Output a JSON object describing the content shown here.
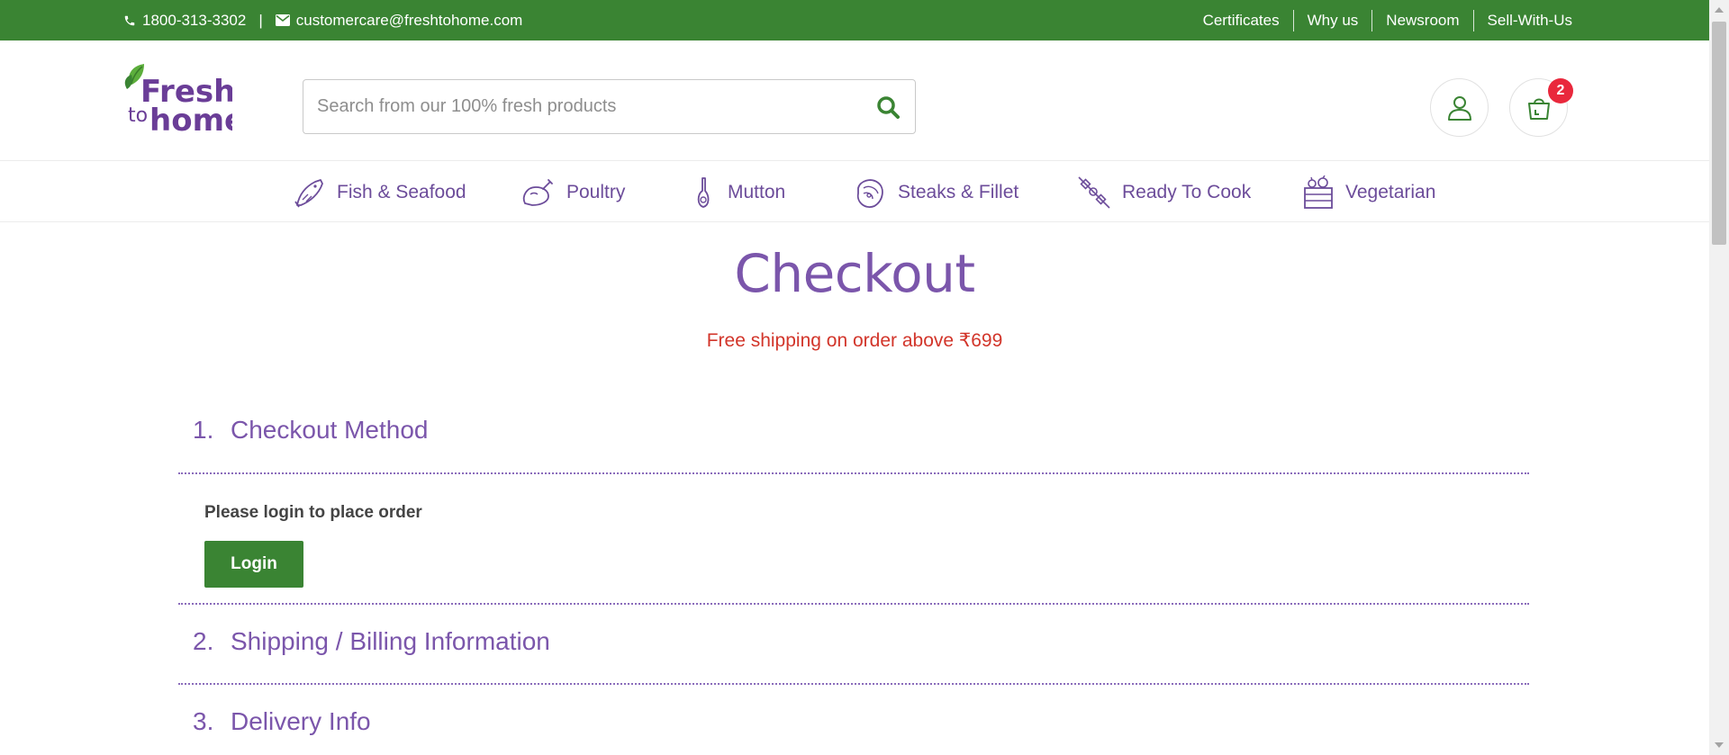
{
  "topbar": {
    "phone": "1800-313-3302",
    "separator": "|",
    "email": "customercare@freshtohome.com",
    "links": [
      "Certificates",
      "Why us",
      "Newsroom",
      "Sell-With-Us"
    ]
  },
  "header": {
    "logo_text": "Fresh to home",
    "search_placeholder": "Search from our 100% fresh products",
    "cart_count": "2"
  },
  "categories": [
    {
      "label": "Fish & Seafood",
      "icon": "fish-icon"
    },
    {
      "label": "Poultry",
      "icon": "chicken-icon"
    },
    {
      "label": "Mutton",
      "icon": "mutton-icon"
    },
    {
      "label": "Steaks & Fillet",
      "icon": "steak-icon"
    },
    {
      "label": "Ready To Cook",
      "icon": "skewer-icon"
    },
    {
      "label": "Vegetarian",
      "icon": "vegetable-basket-icon"
    }
  ],
  "checkout": {
    "title": "Checkout",
    "free_shipping": "Free shipping on order above ₹699",
    "steps": [
      {
        "num": "1.",
        "label": "Checkout Method"
      },
      {
        "num": "2.",
        "label": "Shipping / Billing Information"
      },
      {
        "num": "3.",
        "label": "Delivery Info"
      }
    ],
    "login_message": "Please login to place order",
    "login_button": "Login"
  },
  "colors": {
    "brand_green": "#3a8433",
    "brand_purple": "#7b56ab",
    "alert_red": "#d2352a",
    "badge_red": "#e9283c"
  }
}
